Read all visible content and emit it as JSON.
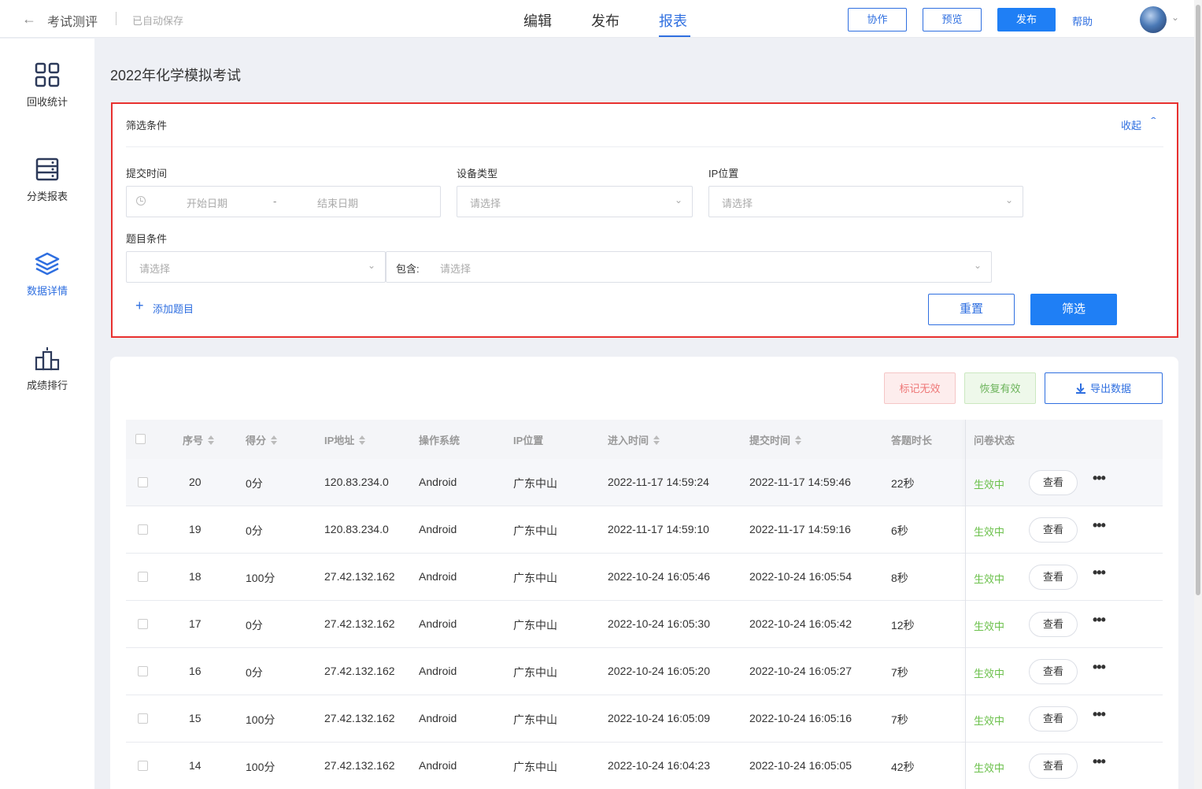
{
  "header": {
    "app_title": "考试测评",
    "autosave": "已自动保存",
    "tabs": [
      "编辑",
      "发布",
      "报表"
    ],
    "active_tab": "报表",
    "buttons": {
      "collab": "协作",
      "preview": "预览",
      "publish": "发布"
    },
    "help": "帮助"
  },
  "sidebar": {
    "items": [
      {
        "label": "回收统计",
        "icon": "grid-icon"
      },
      {
        "label": "分类报表",
        "icon": "server-list-icon"
      },
      {
        "label": "数据详情",
        "icon": "layers-icon",
        "active": true
      },
      {
        "label": "成绩排行",
        "icon": "podium-icon"
      }
    ]
  },
  "page_title": "2022年化学模拟考试",
  "filter": {
    "title": "筛选条件",
    "collapse": "收起",
    "submit_time_label": "提交时间",
    "start_placeholder": "开始日期",
    "range_sep": "-",
    "end_placeholder": "结束日期",
    "device_label": "设备类型",
    "device_placeholder": "请选择",
    "ip_label": "IP位置",
    "ip_placeholder": "请选择",
    "topic_label": "题目条件",
    "topic_placeholder": "请选择",
    "contain_label": "包含:",
    "contain_placeholder": "请选择",
    "add_topic": "添加题目",
    "reset": "重置",
    "submit": "筛选"
  },
  "actions": {
    "mark_invalid": "标记无效",
    "restore_valid": "恢复有效",
    "export": "导出数据"
  },
  "table": {
    "columns": [
      "序号",
      "得分",
      "IP地址",
      "操作系统",
      "IP位置",
      "进入时间",
      "提交时间",
      "答题时长",
      "问卷状态"
    ],
    "view_label": "查看",
    "rows": [
      {
        "id": "20",
        "score": "0分",
        "ip": "120.83.234.0",
        "os": "Android",
        "loc": "广东中山",
        "enter": "2022-11-17 14:59:24",
        "submit": "2022-11-17 14:59:46",
        "duration": "22秒",
        "status": "生效中"
      },
      {
        "id": "19",
        "score": "0分",
        "ip": "120.83.234.0",
        "os": "Android",
        "loc": "广东中山",
        "enter": "2022-11-17 14:59:10",
        "submit": "2022-11-17 14:59:16",
        "duration": "6秒",
        "status": "生效中"
      },
      {
        "id": "18",
        "score": "100分",
        "ip": "27.42.132.162",
        "os": "Android",
        "loc": "广东中山",
        "enter": "2022-10-24 16:05:46",
        "submit": "2022-10-24 16:05:54",
        "duration": "8秒",
        "status": "生效中"
      },
      {
        "id": "17",
        "score": "0分",
        "ip": "27.42.132.162",
        "os": "Android",
        "loc": "广东中山",
        "enter": "2022-10-24 16:05:30",
        "submit": "2022-10-24 16:05:42",
        "duration": "12秒",
        "status": "生效中"
      },
      {
        "id": "16",
        "score": "0分",
        "ip": "27.42.132.162",
        "os": "Android",
        "loc": "广东中山",
        "enter": "2022-10-24 16:05:20",
        "submit": "2022-10-24 16:05:27",
        "duration": "7秒",
        "status": "生效中"
      },
      {
        "id": "15",
        "score": "100分",
        "ip": "27.42.132.162",
        "os": "Android",
        "loc": "广东中山",
        "enter": "2022-10-24 16:05:09",
        "submit": "2022-10-24 16:05:16",
        "duration": "7秒",
        "status": "生效中"
      },
      {
        "id": "14",
        "score": "100分",
        "ip": "27.42.132.162",
        "os": "Android",
        "loc": "广东中山",
        "enter": "2022-10-24 16:04:23",
        "submit": "2022-10-24 16:05:05",
        "duration": "42秒",
        "status": "生效中"
      }
    ]
  },
  "colors": {
    "primary": "#1f7ff5",
    "link": "#2f6fe0",
    "highlight_border": "#e8312f",
    "status_active": "#6bc04b"
  }
}
